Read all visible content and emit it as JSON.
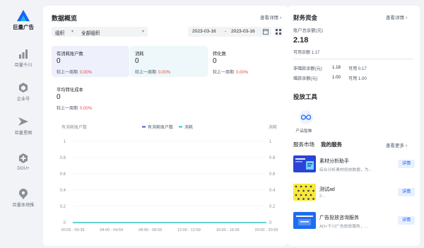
{
  "colors": {
    "brand": "#1664ff",
    "metric1_bg": "#eef0fb",
    "metric2_bg": "#eef7f9",
    "series1": "#3b5bdb",
    "series2": "#2fc4bd",
    "negative": "#f53f3f",
    "link": "#165dff"
  },
  "sidebar": {
    "brand": {
      "label": "巨量广告",
      "icon": "ocean-engine-logo-icon"
    },
    "items": [
      {
        "label": "巨量千川",
        "icon": "bar-chart-icon"
      },
      {
        "label": "企业号",
        "icon": "hexagon-cube-icon"
      },
      {
        "label": "巨量星图",
        "icon": "star-map-icon"
      },
      {
        "label": "DOU+",
        "icon": "dou-plus-icon"
      },
      {
        "label": "巨量本地推",
        "icon": "location-pin-icon"
      }
    ]
  },
  "overview": {
    "title": "数据概览",
    "view_detail": "查看详情",
    "filter": {
      "label": "组织",
      "value": "全部组织"
    },
    "date_start": "2023-03-16",
    "date_sep": "-",
    "date_end": "2023-03-16",
    "metrics": [
      {
        "label": "有消耗账户数",
        "value": "0",
        "compare": "较上一周期",
        "pct": "0.00%"
      },
      {
        "label": "消耗",
        "value": "0",
        "compare": "较上一周期",
        "pct": "0.00%"
      },
      {
        "label": "转化数",
        "value": "0",
        "compare": "较上一周期",
        "pct": "0.00%"
      },
      {
        "label": "平均转化成本",
        "value": "0",
        "compare": "较上一周期",
        "pct": "0.00%"
      }
    ]
  },
  "chart_data": {
    "type": "line",
    "left_axis_label": "有消耗账户数",
    "right_axis_label": "消耗",
    "categories": [
      "00:05 - 00:39",
      "04:00 - 04:59",
      "08:00 - 08:59",
      "12:00 - 12:59",
      "16:00 - 16:59",
      "20:00 - 20:59"
    ],
    "yticks": [
      "1",
      "0.8",
      "0.6",
      "0.4",
      "0.2",
      "0"
    ],
    "ylim": [
      0,
      1
    ],
    "series": [
      {
        "name": "有消耗账户数",
        "values": [
          0,
          0,
          0,
          0,
          0,
          0
        ]
      },
      {
        "name": "消耗",
        "values": [
          0,
          0,
          0,
          0,
          0,
          0
        ]
      }
    ],
    "legend_position": "top-center",
    "grid": true
  },
  "finance": {
    "title": "财务资金",
    "view_detail": "查看详情",
    "total_label": "账户总余额(元)",
    "total_value": "2.18",
    "available_label": "可用余额",
    "available_value": "1.17",
    "rows": [
      {
        "label": "非赠款余额(元)",
        "value": "1.18",
        "avail_label": "可用",
        "avail_value": "0.17"
      },
      {
        "label": "赠款余额(元)",
        "value": "1.00",
        "avail_label": "可用",
        "avail_value": "1.00"
      }
    ]
  },
  "tools": {
    "title": "投放工具",
    "items": [
      {
        "label": "产品智推",
        "icon": "infinity-loop-icon"
      }
    ]
  },
  "services": {
    "tabs": [
      "服务市场",
      "我的服务"
    ],
    "view_more": "查看更多",
    "items": [
      {
        "name": "素材分析助手",
        "desc": "综合分析素材投放数据，为...",
        "action": "详情"
      },
      {
        "name": "测试ad",
        "desc": "2...",
        "action": "详情"
      },
      {
        "name": "广告投放咨询服务",
        "desc": "AD+千川广告投放服务，...",
        "action": "详情"
      }
    ]
  }
}
